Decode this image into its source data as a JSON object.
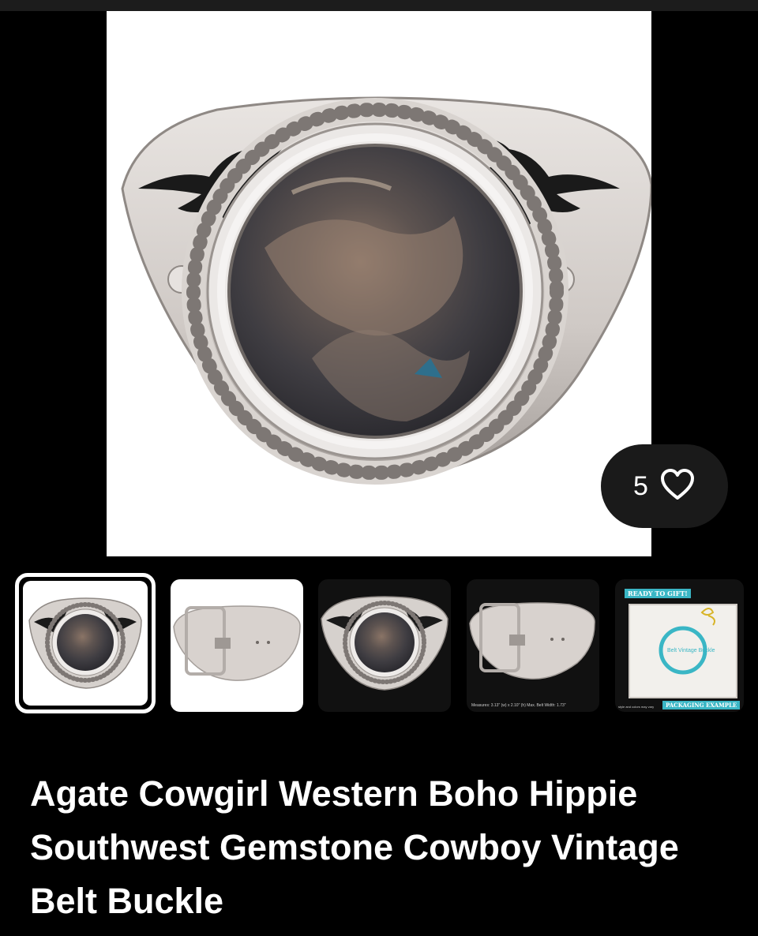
{
  "product": {
    "title": "Agate Cowgirl Western Boho Hippie Southwest Gemstone Cowboy Vintage Belt Buckle",
    "favorites_count": "5",
    "main_image": "agate-belt-buckle-front",
    "thumbnails": [
      {
        "name": "buckle-front",
        "selected": true
      },
      {
        "name": "buckle-back",
        "selected": false
      },
      {
        "name": "buckle-front-dark",
        "selected": false
      },
      {
        "name": "buckle-back-measurements",
        "selected": false,
        "caption": "Measures: 3.13\" (w) x 2.10\" (h) Max. Belt Width: 1.73\""
      },
      {
        "name": "gift-packaging",
        "selected": false,
        "top_label": "READY TO GIFT!",
        "bottom_label": "PACKAGING EXAMPLE",
        "note": "style and colors may vary",
        "box_label": "Belt Vintage Buckle"
      }
    ]
  },
  "icons": {
    "favorite": "heart-outline-icon"
  },
  "colors": {
    "background": "#000000",
    "pill": "#1a1a1a",
    "accent": "#3ab6c5",
    "text": "#ffffff"
  }
}
